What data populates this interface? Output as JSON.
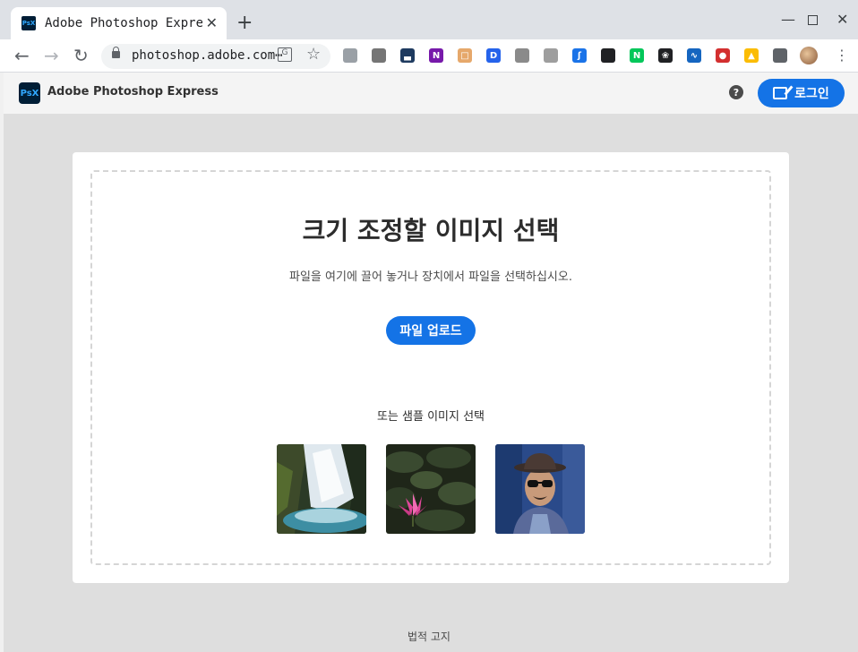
{
  "browser": {
    "tab_title": "Adobe Photoshop Express",
    "tab_favicon": "PsX",
    "url": "photoshop.adobe.com⋯",
    "extensions": [
      {
        "name": "notifications-icon",
        "color": "#9aa0a6",
        "glyph": ""
      },
      {
        "name": "camera-icon",
        "color": "#757575",
        "glyph": ""
      },
      {
        "name": "chart-extension-icon",
        "color": "#1e3a5f",
        "glyph": "▃"
      },
      {
        "name": "onenote-extension-icon",
        "color": "#7719aa",
        "glyph": "N"
      },
      {
        "name": "face-extension-icon",
        "color": "#e6a86b",
        "glyph": "□"
      },
      {
        "name": "d-extension-icon",
        "color": "#2563eb",
        "glyph": "D"
      },
      {
        "name": "hexagon-extension-icon",
        "color": "#8a8a8a",
        "glyph": ""
      },
      {
        "name": "shield-extension-icon",
        "color": "#9e9e9e",
        "glyph": ""
      },
      {
        "name": "translate-extension-icon",
        "color": "#1a73e8",
        "glyph": "ʃ"
      },
      {
        "name": "picture-in-picture-icon",
        "color": "#202124",
        "glyph": ""
      },
      {
        "name": "naver-extension-icon",
        "color": "#03c75a",
        "glyph": "N"
      },
      {
        "name": "paw-extension-icon",
        "color": "#202124",
        "glyph": "❀"
      },
      {
        "name": "wave-extension-icon",
        "color": "#1565c0",
        "glyph": "∿"
      },
      {
        "name": "red-extension-icon",
        "color": "#d32f2f",
        "glyph": "●"
      },
      {
        "name": "google-drive-icon",
        "color": "#fbbc04",
        "glyph": "▲"
      },
      {
        "name": "puzzle-extensions-icon",
        "color": "#5f6368",
        "glyph": ""
      }
    ],
    "accent": "#1a73e8"
  },
  "app": {
    "logo_text": "PsX",
    "name": "Adobe Photoshop Express",
    "help_glyph": "?",
    "login_label": "로그인",
    "brand_color": "#1473e6"
  },
  "main": {
    "heading": "크기 조정할 이미지 선택",
    "subtext": "파일을 여기에 끌어 놓거나 장치에서 파일을 선택하십시오.",
    "upload_label": "파일 업로드",
    "sample_label": "또는 샘플 이미지 선택",
    "samples": [
      {
        "name": "waterfall-sample"
      },
      {
        "name": "lotus-sample"
      },
      {
        "name": "portrait-sample"
      }
    ]
  },
  "footer": {
    "legal_label": "법적 고지"
  }
}
